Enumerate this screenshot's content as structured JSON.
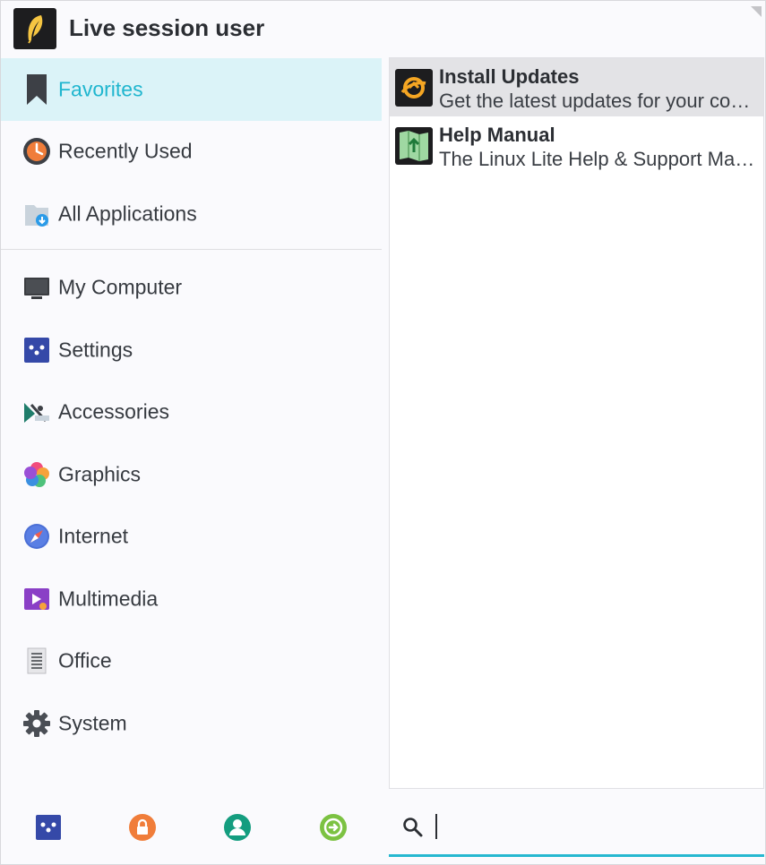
{
  "header": {
    "username": "Live session user"
  },
  "sidebar": {
    "categories": [
      {
        "label": "Favorites",
        "icon": "bookmark-icon",
        "active": true
      },
      {
        "label": "Recently Used",
        "icon": "recently-used-icon"
      },
      {
        "label": "All Applications",
        "icon": "all-applications-icon"
      }
    ],
    "groups": [
      {
        "label": "My Computer",
        "icon": "computer-icon"
      },
      {
        "label": "Settings",
        "icon": "settings-icon"
      },
      {
        "label": "Accessories",
        "icon": "accessories-icon"
      },
      {
        "label": "Graphics",
        "icon": "graphics-icon"
      },
      {
        "label": "Internet",
        "icon": "internet-icon"
      },
      {
        "label": "Multimedia",
        "icon": "multimedia-icon"
      },
      {
        "label": "Office",
        "icon": "office-icon"
      },
      {
        "label": "System",
        "icon": "system-gear-icon"
      }
    ]
  },
  "apps": [
    {
      "name": "Install Updates",
      "description": "Get the latest updates for your computer",
      "icon": "install-updates-icon",
      "selected": true
    },
    {
      "name": "Help Manual",
      "description": "The Linux Lite Help & Support Manual",
      "icon": "help-manual-icon"
    }
  ],
  "bottom_actions": [
    {
      "name": "settings-manager-button",
      "icon": "settings-manager-icon"
    },
    {
      "name": "lock-screen-button",
      "icon": "lock-icon"
    },
    {
      "name": "switch-user-button",
      "icon": "user-icon"
    },
    {
      "name": "log-out-button",
      "icon": "log-out-icon"
    }
  ],
  "search": {
    "value": "",
    "placeholder": ""
  },
  "colors": {
    "accent": "#20b6cf",
    "active_bg": "#dbf3f8",
    "selected_bg": "#e3e3e6"
  }
}
